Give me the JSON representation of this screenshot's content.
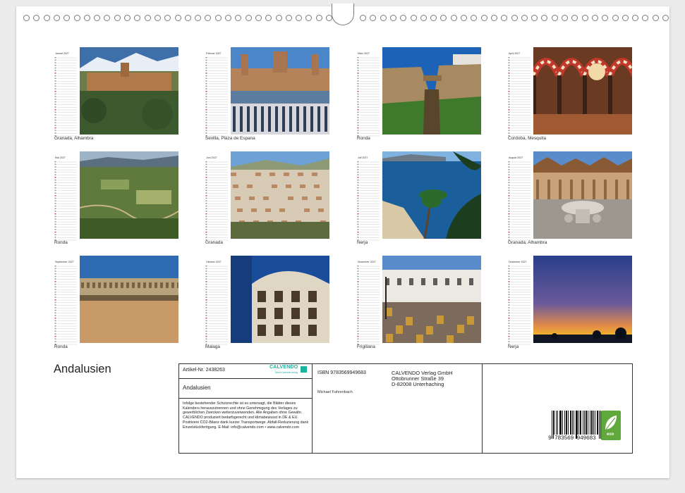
{
  "months": [
    {
      "name": "Januar 2027",
      "caption": "Granada, Alhambra",
      "scene": "alhambra"
    },
    {
      "name": "Februar 2027",
      "caption": "Sevilla, Plaza de Espana",
      "scene": "plaza"
    },
    {
      "name": "März 2027",
      "caption": "Ronda",
      "scene": "rondagorge"
    },
    {
      "name": "April 2027",
      "caption": "Cordoba, Mesquita",
      "scene": "mezquita"
    },
    {
      "name": "Mai 2027",
      "caption": "Ronda",
      "scene": "valley"
    },
    {
      "name": "Juni 2027",
      "caption": "Granada",
      "scene": "town"
    },
    {
      "name": "Juli 2027",
      "caption": "Nerja",
      "scene": "sea"
    },
    {
      "name": "August 2027",
      "caption": "Granada, Alhambra",
      "scene": "lions"
    },
    {
      "name": "September 2027",
      "caption": "Ronda",
      "scene": "bullring"
    },
    {
      "name": "Oktober 2027",
      "caption": "Malaga",
      "scene": "building"
    },
    {
      "name": "November 2027",
      "caption": "Frigiliana",
      "scene": "cafe"
    },
    {
      "name": "Dezember 2027",
      "caption": "Nerja",
      "scene": "sunset"
    }
  ],
  "title": "Andalusien",
  "info": {
    "article": "Artikel-Nr. 2438263",
    "calvendo_logo": "CALVENDO",
    "calvendo_sub": "Mein Kalenderverlag",
    "product_title": "Andalusien",
    "legal": "Infolge bestehender Schutzrechte ist es untersagt, die Blätter dieses Kalenders herauszutrennen und ohne Genehmigung des Verlages zu gewerblichen Zwecken weiterzuverwenden. Alle Angaben ohne Gewähr. CALVENDO produziert bedarfsgerecht und klimabewusst in DE & EU. Positivere CO2-Bilanz dank kurzer Transportwege. Abfall-Reduzierung dank Einzelstückfertigung. E-Mail: info@calvendo.com • www.calvendo.com",
    "isbn": "ISBN 9783569949683",
    "author": "Michael Fahrenbach",
    "publisher_line1": "CALVENDO Verlag GmbH",
    "publisher_line2": "Ottobrunner Straße 39",
    "publisher_line3": "D-82008 Unterhaching",
    "barcode_text": "9 783569 949683",
    "eco_label": "eco"
  },
  "colors": {
    "accent_logo": "#19b3a0",
    "eco_green": "#5fa83c",
    "border": "#333333"
  }
}
